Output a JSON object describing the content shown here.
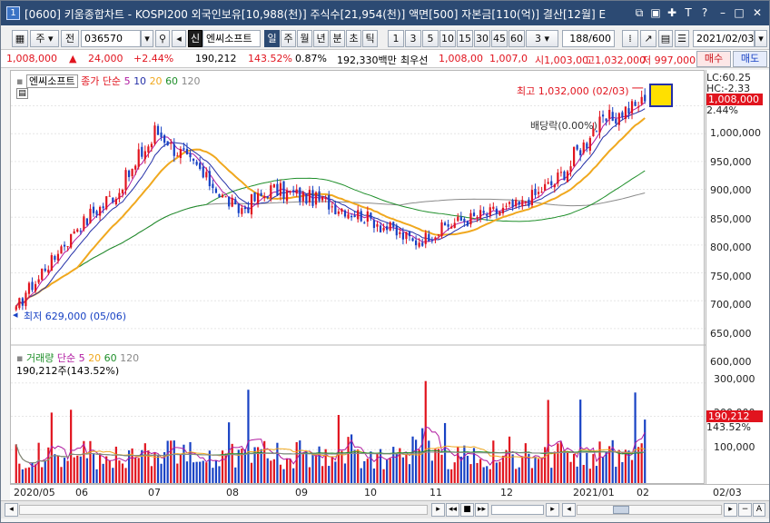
{
  "title_bar": {
    "window_number": "1",
    "title": "[0600] 키움종합차트 - KOSPI200 외국인보유[10,988(천)] 주식수[21,954(천)] 액면[500] 자본금[110(억)] 결산[12월] E"
  },
  "toolbar": {
    "period_select": "주",
    "prev_button": "전",
    "code": "036570",
    "credit_badge": "신",
    "stock_name": "엔씨소프트",
    "periods": [
      "일",
      "주",
      "월",
      "년",
      "분",
      "초",
      "틱"
    ],
    "active_period": "일",
    "intervals": [
      "1",
      "3",
      "5",
      "10",
      "15",
      "30",
      "45",
      "60"
    ],
    "interval_select": "3",
    "count": "188/600",
    "date": "2021/02/03"
  },
  "quote": {
    "price": "1,008,000",
    "change_arrow": "▲",
    "change": "24,000",
    "change_pct": "+2.44%",
    "volume": "190,212",
    "volume_ratio": "143.52%",
    "turnover": "0.87%",
    "amount": "192,330백만",
    "best_label": "최우선",
    "ask": "1,008,00",
    "bid": "1,007,0",
    "open": "시1,003,00",
    "high": "고1,032,000",
    "low": "저 997,000",
    "buy_button": "매수",
    "sell_button": "매도"
  },
  "chart": {
    "stock_label": "엔씨소프트",
    "ma_legend_prefix": "종가 단순",
    "ma_periods": [
      "5",
      "10",
      "20",
      "60",
      "120"
    ],
    "lc": "LC:60.25",
    "hc": "HC:-2.33",
    "current_price_tag": "1,008,000",
    "current_pct_tag": "2.44%",
    "high_annotation": "최고 1,032,000 (02/03)",
    "low_annotation": "최저 629,000 (05/06)",
    "dividend_annotation": "배당락(0.00%)",
    "price_axis": [
      "1,000,000",
      "950,000",
      "900,000",
      "850,000",
      "800,000",
      "750,000",
      "700,000",
      "650,000",
      "600,000"
    ],
    "volume_legend_label": "거래량",
    "volume_legend_prefix": "단순",
    "volume_ma_periods": [
      "5",
      "20",
      "60",
      "120"
    ],
    "volume_current": "190,212주(143.52%)",
    "volume_axis": [
      "300,000",
      "200,000",
      "100,000"
    ],
    "volume_tag": "190,212",
    "volume_pct_tag": "143.52%",
    "date_axis": [
      "2020/05",
      "06",
      "07",
      "08",
      "09",
      "10",
      "11",
      "12",
      "2021/01",
      "02"
    ],
    "axis_date_right": "02/03"
  },
  "colors": {
    "up": "#e1141e",
    "down": "#1842c4",
    "ma5": "#b01aa0",
    "ma10": "#2430a8",
    "ma20": "#f0a81e",
    "ma60": "#1f8f2a",
    "ma120": "#8a8a8a",
    "title_bg": "#2c4a73"
  },
  "chart_data": {
    "type": "candlestick",
    "title": "",
    "x_range": [
      "2020/05",
      "2021/02"
    ],
    "ylim": [
      590000,
      1040000
    ],
    "trend_anchors": [
      {
        "date": "2020/05/06",
        "close": 640000
      },
      {
        "date": "2020/06/01",
        "close": 780000
      },
      {
        "date": "2020/06/20",
        "close": 850000
      },
      {
        "date": "2020/07/06",
        "close": 955000
      },
      {
        "date": "2020/07/25",
        "close": 880000
      },
      {
        "date": "2020/08/10",
        "close": 810000
      },
      {
        "date": "2020/08/25",
        "close": 850000
      },
      {
        "date": "2020/09/15",
        "close": 830000
      },
      {
        "date": "2020/10/05",
        "close": 800000
      },
      {
        "date": "2020/10/26",
        "close": 755000
      },
      {
        "date": "2020/11/12",
        "close": 790000
      },
      {
        "date": "2020/12/10",
        "close": 820000
      },
      {
        "date": "2020/12/28",
        "close": 870000
      },
      {
        "date": "2021/01/12",
        "close": 960000
      },
      {
        "date": "2021/01/25",
        "close": 990000
      },
      {
        "date": "2021/02/03",
        "close": 1008000
      }
    ],
    "high": {
      "value": 1032000,
      "date": "2021/02/03"
    },
    "low": {
      "value": 629000,
      "date": "2020/05/06"
    },
    "last_close": 1008000,
    "last_volume": 190212,
    "volume_ylim": [
      0,
      370000
    ],
    "moving_averages": [
      "5",
      "10",
      "20",
      "60",
      "120"
    ]
  }
}
